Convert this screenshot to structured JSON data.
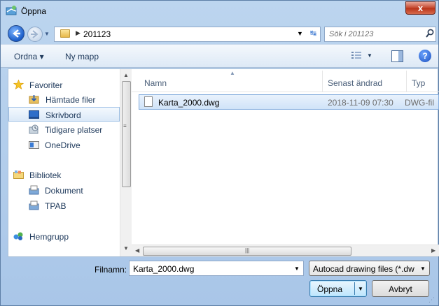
{
  "window": {
    "title": "Öppna",
    "close": "x"
  },
  "nav": {
    "address_path": "201123",
    "search_placeholder": "Sök i 201123"
  },
  "toolbar": {
    "organize": "Ordna ▾",
    "new_folder": "Ny mapp"
  },
  "sidebar": {
    "items": [
      {
        "label": "Favoriter",
        "icon": "star-icon"
      },
      {
        "label": "Hämtade filer",
        "icon": "downloads-icon"
      },
      {
        "label": "Skrivbord",
        "icon": "desktop-icon"
      },
      {
        "label": "Tidigare platser",
        "icon": "recent-places-icon"
      },
      {
        "label": "OneDrive",
        "icon": "onedrive-icon"
      },
      {
        "label": "Bibliotek",
        "icon": "library-icon"
      },
      {
        "label": "Dokument",
        "icon": "documents-icon"
      },
      {
        "label": "TPAB",
        "icon": "tpab-icon"
      },
      {
        "label": "Hemgrupp",
        "icon": "homegroup-icon"
      }
    ]
  },
  "files": {
    "columns": {
      "name": "Namn",
      "modified": "Senast ändrad",
      "type": "Typ"
    },
    "rows": [
      {
        "name": "Karta_2000.dwg",
        "modified": "2018-11-09 07:30",
        "type": "DWG-fil"
      }
    ]
  },
  "bottom": {
    "filename_label": "Filnamn:",
    "filename_value": "Karta_2000.dwg",
    "filter": "Autocad drawing files (*.dw",
    "open": "Öppna",
    "cancel": "Avbryt"
  },
  "colors": {
    "selection": "#cce8ff",
    "accent": "#1e395b",
    "frame": "#bcd5ef"
  }
}
